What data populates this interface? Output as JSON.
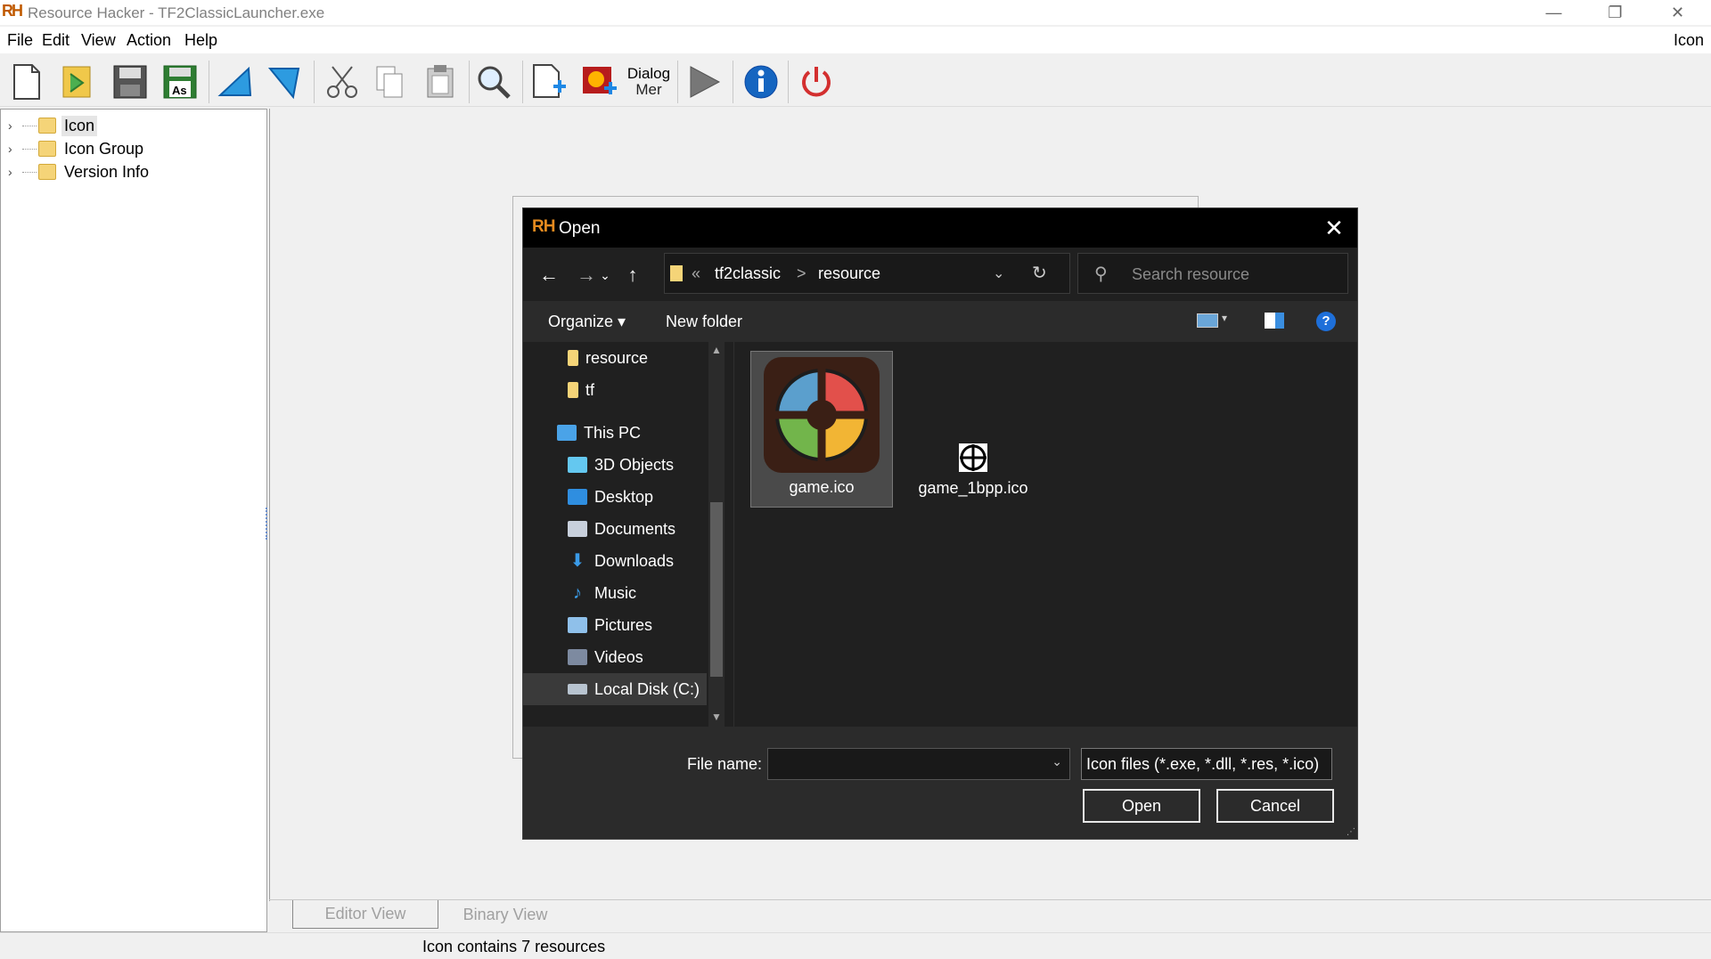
{
  "window": {
    "logo": "RH",
    "title": "Resource Hacker - TF2ClassicLauncher.exe",
    "controls": {
      "minimize": "—",
      "restore": "❐",
      "close": "✕"
    }
  },
  "menubar": {
    "items": [
      "File",
      "Edit",
      "View",
      "Action",
      "Help"
    ],
    "right_label": "Icon"
  },
  "toolbar": {
    "dialog_menu_label_1": "Dialog",
    "dialog_menu_label_2": "Mer"
  },
  "tree": {
    "items": [
      {
        "label": "Icon",
        "selected": true
      },
      {
        "label": "Icon Group",
        "selected": false
      },
      {
        "label": "Version Info",
        "selected": false
      }
    ]
  },
  "tabs": {
    "editor": "Editor View",
    "binary": "Binary View"
  },
  "status": {
    "text": "Icon contains 7 resources"
  },
  "dialog": {
    "logo": "RH",
    "title": "Open",
    "address": {
      "overflow": "«",
      "crumbs": [
        "tf2classic",
        "resource"
      ],
      "sep": ">"
    },
    "search_placeholder": "Search resource",
    "commands": {
      "organize": "Organize ▾",
      "new_folder": "New folder"
    },
    "nav_items": [
      {
        "label": "resource",
        "icon": "folder-icon",
        "color": "#f5d478"
      },
      {
        "label": "tf",
        "icon": "folder-icon",
        "color": "#f5d478"
      },
      {
        "label": "This PC",
        "icon": "computer-icon",
        "color": "#4aa3e8"
      },
      {
        "label": "3D Objects",
        "icon": "cube-icon",
        "color": "#64c8f0"
      },
      {
        "label": "Desktop",
        "icon": "desktop-icon",
        "color": "#2f8ee0"
      },
      {
        "label": "Documents",
        "icon": "documents-icon",
        "color": "#c8d0dc"
      },
      {
        "label": "Downloads",
        "icon": "download-icon",
        "color": "#3a9be8"
      },
      {
        "label": "Music",
        "icon": "music-icon",
        "color": "#3a9be8"
      },
      {
        "label": "Pictures",
        "icon": "pictures-icon",
        "color": "#8fc0ea"
      },
      {
        "label": "Videos",
        "icon": "videos-icon",
        "color": "#7d8aa0"
      },
      {
        "label": "Local Disk (C:)",
        "icon": "disk-icon",
        "color": "#b8c4d0"
      }
    ],
    "files": [
      {
        "name": "game.ico",
        "selected": true
      },
      {
        "name": "game_1bpp.ico",
        "selected": false
      }
    ],
    "file_name_label": "File name:",
    "file_name_value": "",
    "file_type": "Icon files (*.exe, *.dll, *.res, *.ico)",
    "open_label": "Open",
    "cancel_label": "Cancel"
  },
  "colors": {
    "dialog_bg": "#202020",
    "dialog_title_bg": "#000000",
    "accent_orange": "#e58a1f",
    "tf2_blue": "#5b9fcd",
    "tf2_red": "#e2504b",
    "tf2_green": "#72b54b",
    "tf2_yellow": "#f2b534",
    "tf2_bg": "#3a1f15"
  }
}
